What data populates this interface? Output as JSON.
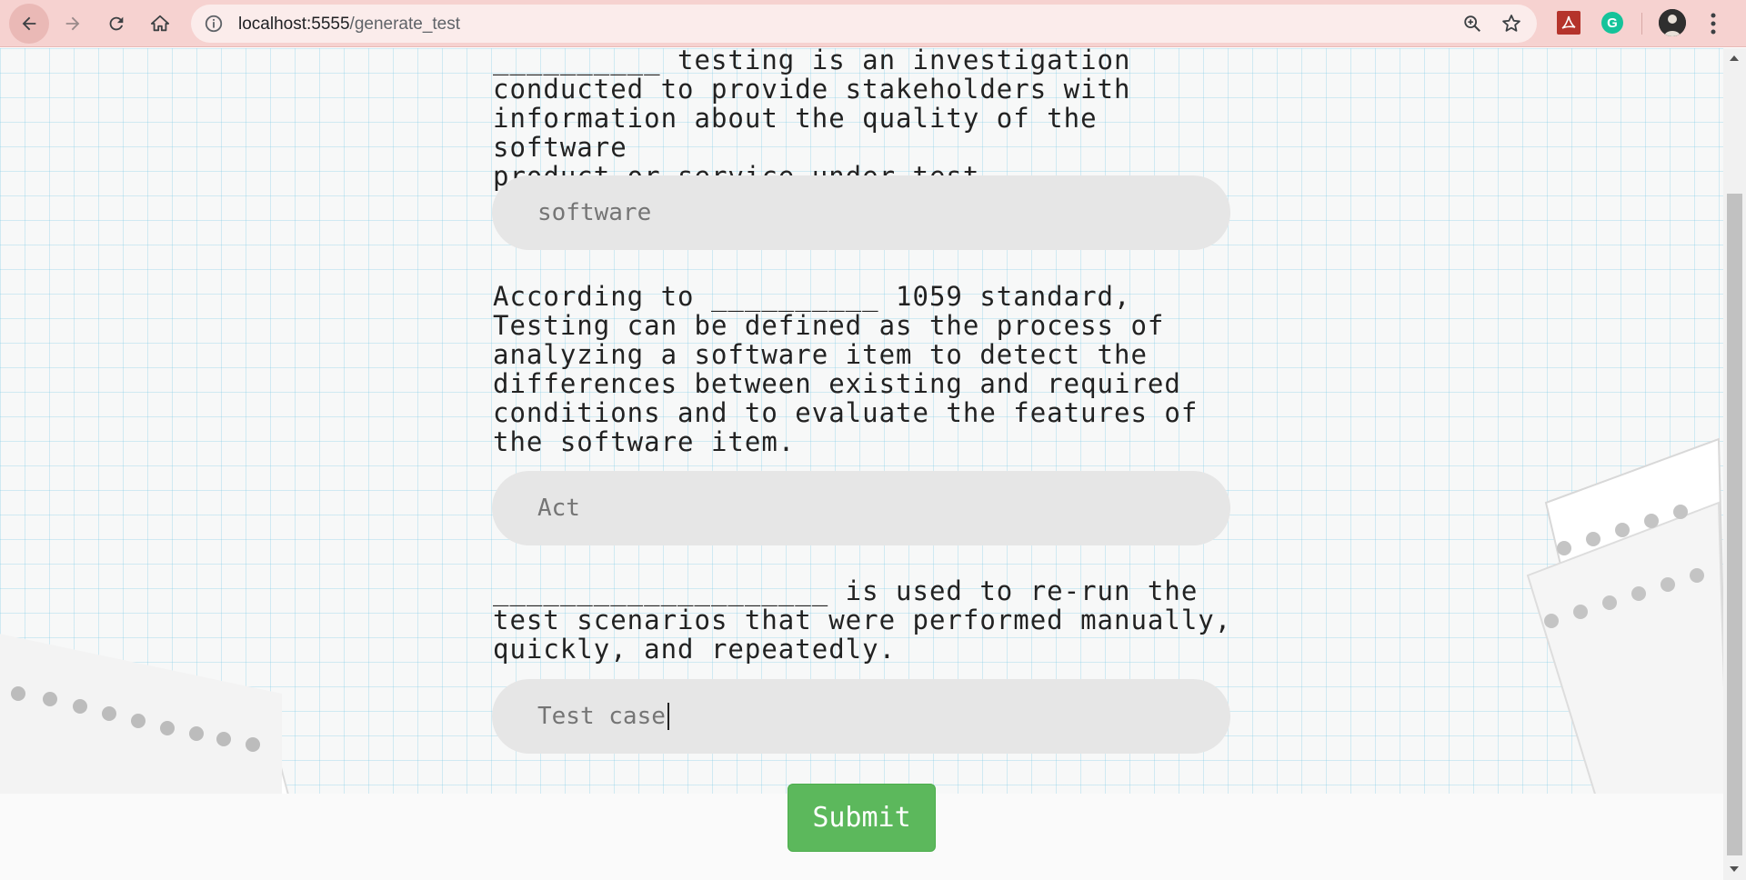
{
  "browser": {
    "url_host": "localhost:5555",
    "url_path": "/generate_test"
  },
  "questions": [
    {
      "text": "__________ testing is an investigation\nconducted to provide stakeholders with\ninformation about the quality of the software\nproduct or service under test.",
      "answer": "software"
    },
    {
      "text": "According to __________ 1059 standard,\nTesting can be defined as the process of\nanalyzing a software item to detect the\ndifferences between existing and required\nconditions and to evaluate the features of\nthe software item.",
      "answer": "Act"
    },
    {
      "text": "____________________ is used to re-run the\ntest scenarios that were performed manually,\nquickly, and repeatedly.",
      "answer": "Test case"
    }
  ],
  "submit_label": "Submit",
  "colors": {
    "chrome": "#f6d2d0",
    "submit": "#5cb85c",
    "field": "#e6e6e6"
  }
}
